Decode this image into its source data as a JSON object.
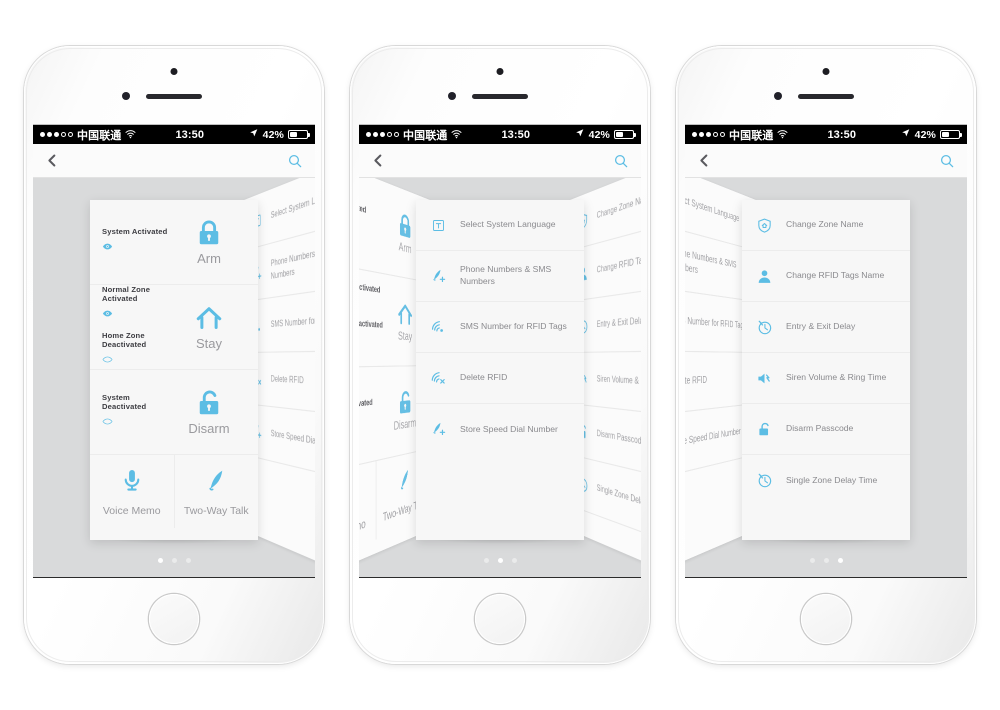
{
  "statusbar": {
    "carrier": "中国联通",
    "wifi_icon": "wifi-icon",
    "time": "13:50",
    "location_icon": "location-arrow-icon",
    "battery_percent": "42%",
    "signal_dots_filled": 3,
    "signal_dots_total": 5
  },
  "navbar": {
    "back_icon": "back-chevron-icon",
    "search_icon": "search-icon"
  },
  "colors": {
    "accent_blue": "#5cbde4",
    "screen_bg": "#d9dadb",
    "card_bg": "#f7f7f7",
    "label_gray": "#8a8a8e",
    "caption_gray": "#9a9a9e"
  },
  "phones": [
    {
      "id": "phone-1",
      "page_dots": {
        "total": 3,
        "active": 0
      },
      "panel_type": "status",
      "status_rows": [
        {
          "states": [
            {
              "label": "System Activated",
              "eye": "filled"
            }
          ],
          "icon": "lock-closed-icon",
          "caption": "Arm"
        },
        {
          "states": [
            {
              "label": "Normal Zone Activated",
              "eye": "filled"
            },
            {
              "label": "Home Zone Deactivated",
              "eye": "outline"
            }
          ],
          "icon": "home-icon",
          "caption": "Stay"
        },
        {
          "states": [
            {
              "label": "System Deactivated",
              "eye": "outline"
            }
          ],
          "icon": "lock-open-icon",
          "caption": "Disarm"
        }
      ],
      "bottom_cells": [
        {
          "icon": "microphone-icon",
          "caption": "Voice Memo"
        },
        {
          "icon": "phone-handset-icon",
          "caption": "Two-Way Talk"
        }
      ]
    },
    {
      "id": "phone-2",
      "page_dots": {
        "total": 3,
        "active": 1
      },
      "panel_type": "list",
      "list_items": [
        {
          "icon": "text-box-icon",
          "label": "Select System Language"
        },
        {
          "icon": "phone-add-icon",
          "label": "Phone Numbers & SMS Numbers"
        },
        {
          "icon": "rfid-signal-icon",
          "label": "SMS Number for RFID Tags"
        },
        {
          "icon": "rfid-signal-x-icon",
          "label": "Delete RFID"
        },
        {
          "icon": "phone-add-icon",
          "label": "Store Speed Dial Number"
        }
      ]
    },
    {
      "id": "phone-3",
      "page_dots": {
        "total": 3,
        "active": 2
      },
      "panel_type": "list",
      "list_items": [
        {
          "icon": "shield-home-icon",
          "label": "Change Zone Name"
        },
        {
          "icon": "person-icon",
          "label": "Change RFID Tags Name"
        },
        {
          "icon": "timer-icon",
          "label": "Entry & Exit Delay"
        },
        {
          "icon": "speaker-icon",
          "label": "Siren Volume & Ring Time"
        },
        {
          "icon": "unlock-icon",
          "label": "Disarm Passcode"
        },
        {
          "icon": "timer-icon",
          "label": "Single Zone Delay Time"
        }
      ]
    }
  ]
}
